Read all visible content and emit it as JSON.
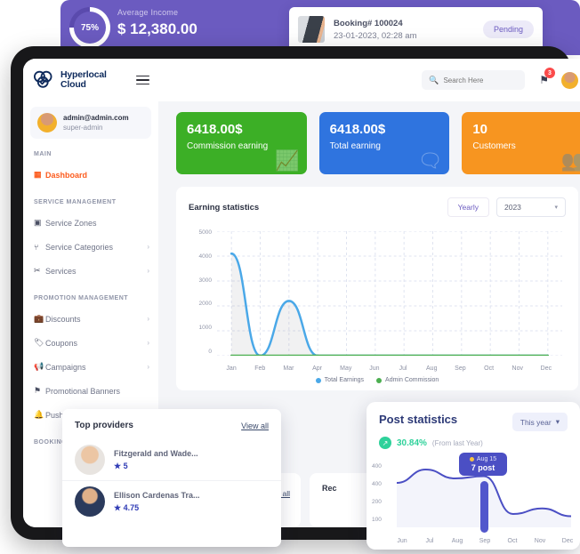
{
  "promo": {
    "percent": "75%",
    "label": "Average Income",
    "value": "$ 12,380.00",
    "accent": "#6b5bc0"
  },
  "booking_card": {
    "id": "Booking# 100024",
    "datetime": "23-01-2023, 02:28 am",
    "status": "Pending",
    "thumb_icon": "booking-thumbnail"
  },
  "brand": {
    "name_line1": "Hyperlocal",
    "name_line2": "Cloud",
    "logo_icon": "cloud-logo-icon",
    "menu_icon": "hamburger-icon"
  },
  "user": {
    "email": "admin@admin.com",
    "role": "super-admin",
    "avatar_icon": "user-avatar"
  },
  "topbar": {
    "search_placeholder": "Search Here",
    "search_value": "",
    "search_icon": "search-icon",
    "notification_icon": "flag-icon",
    "notification_count": "3",
    "avatar_icon": "user-avatar"
  },
  "sidebar": {
    "sections": [
      {
        "title": "MAIN",
        "items": [
          {
            "label": "Dashboard",
            "icon": "grid-icon",
            "active": true,
            "caret": ""
          }
        ]
      },
      {
        "title": "SERVICE MANAGEMENT",
        "items": [
          {
            "label": "Service Zones",
            "icon": "map-icon",
            "active": false,
            "caret": ""
          },
          {
            "label": "Service Categories",
            "icon": "hierarchy-icon",
            "active": false,
            "caret": "›"
          },
          {
            "label": "Services",
            "icon": "tools-icon",
            "active": false,
            "caret": "›"
          }
        ]
      },
      {
        "title": "PROMOTION MANAGEMENT",
        "items": [
          {
            "label": "Discounts",
            "icon": "briefcase-icon",
            "active": false,
            "caret": "›"
          },
          {
            "label": "Coupons",
            "icon": "tag-icon",
            "active": false,
            "caret": "›"
          },
          {
            "label": "Campaigns",
            "icon": "megaphone-icon",
            "active": false,
            "caret": "›"
          },
          {
            "label": "Promotional Banners",
            "icon": "flag-icon",
            "active": false,
            "caret": ""
          },
          {
            "label": "Push Notifications",
            "icon": "bell-icon",
            "active": false,
            "caret": ""
          }
        ]
      },
      {
        "title": "BOOKING MANAGEMENT",
        "items": []
      }
    ]
  },
  "stats": [
    {
      "value": "6418.00$",
      "label": "Commission earning",
      "color": "#3caf26",
      "icon": "earnings-chart-icon"
    },
    {
      "value": "6418.00$",
      "label": "Total earning",
      "color": "#2f74df",
      "icon": "group-chat-icon"
    },
    {
      "value": "10",
      "label": "Customers",
      "color": "#f79520",
      "icon": "customers-icon"
    }
  ],
  "earning_panel": {
    "title": "Earning statistics",
    "period_button": "Yearly",
    "year_select": "2023",
    "caret_icon": "chevron-down-icon"
  },
  "providers_card": {
    "title": "Top providers",
    "view_all": "View all",
    "star_icon": "star-icon",
    "rows": [
      {
        "name": "Fitzgerald and Wade...",
        "rating": "5",
        "avatar_icon": "provider-avatar"
      },
      {
        "name": "Ellison Cardenas Tra...",
        "rating": "4.75",
        "avatar_icon": "provider-avatar"
      }
    ]
  },
  "background_cards": {
    "view_all": "View all",
    "partial_label": "Rec"
  },
  "post_stats": {
    "title": "Post statistics",
    "percent": "30.84%",
    "from_text": "(From last Year)",
    "trend_icon": "trend-up-icon",
    "period": "This year",
    "period_caret": "chevron-down-icon",
    "tooltip_day": "Aug 15",
    "tooltip_value": "7 post"
  },
  "chart_data": [
    {
      "type": "line",
      "title": "Earning statistics",
      "xlabel": "",
      "ylabel": "",
      "categories": [
        "Jan",
        "Feb",
        "Mar",
        "Apr",
        "May",
        "Jun",
        "Jul",
        "Aug",
        "Sep",
        "Oct",
        "Nov",
        "Dec"
      ],
      "ylim": [
        0,
        5000
      ],
      "yticks": [
        0,
        1000,
        2000,
        3000,
        4000,
        5000
      ],
      "grid": true,
      "legend_position": "bottom",
      "series": [
        {
          "name": "Total Earnings",
          "color": "#4aa8e8",
          "values": [
            4100,
            0,
            2200,
            0,
            0,
            0,
            0,
            0,
            0,
            0,
            0,
            0
          ]
        },
        {
          "name": "Admin Commission",
          "color": "#4caf50",
          "values": [
            0,
            0,
            0,
            0,
            0,
            0,
            0,
            0,
            0,
            0,
            0,
            0
          ]
        }
      ]
    },
    {
      "type": "area",
      "title": "Post statistics",
      "xlabel": "",
      "ylabel": "",
      "categories": [
        "Jun",
        "Jul",
        "Aug",
        "Sep",
        "Oct",
        "Nov",
        "Dec"
      ],
      "ylim": [
        100,
        400
      ],
      "yticks": [
        100,
        200,
        400,
        400
      ],
      "grid": false,
      "legend_position": "none",
      "series": [
        {
          "name": "Posts",
          "color": "#4b4fc4",
          "values": [
            300,
            360,
            320,
            330,
            160,
            185,
            150
          ]
        }
      ],
      "annotation": {
        "x": "Aug 15",
        "label": "7 post"
      }
    }
  ]
}
